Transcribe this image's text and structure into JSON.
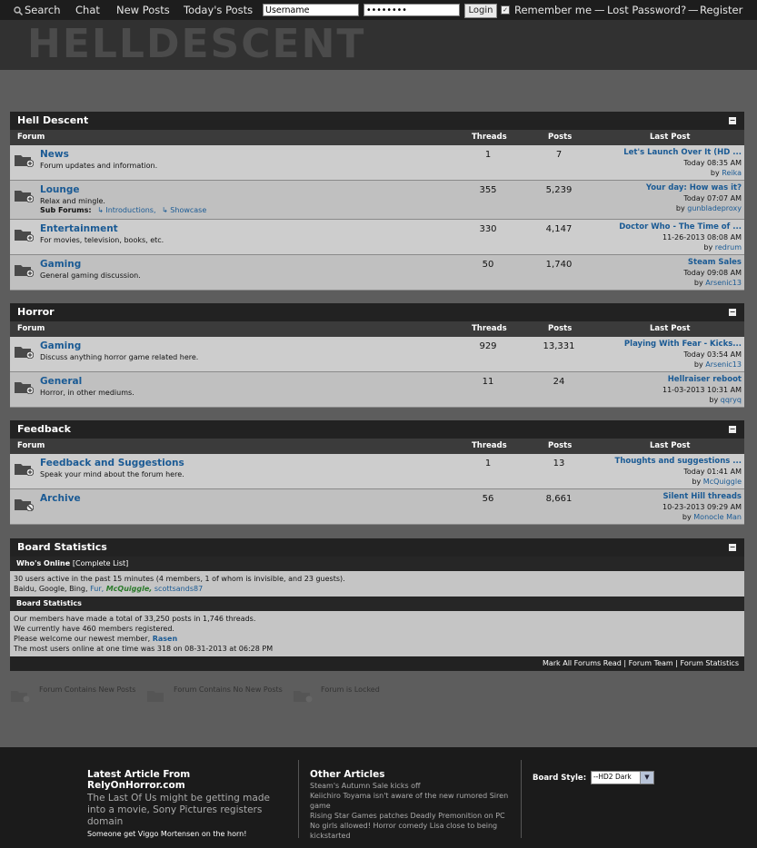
{
  "topnav": {
    "search": "Search",
    "chat": "Chat",
    "new_posts": "New Posts",
    "todays_posts": "Today's Posts",
    "username_value": "Username",
    "password_value": "••••••••",
    "login_label": "Login",
    "remember_label": "Remember me",
    "dash1": "—",
    "lost_password": "Lost Password?",
    "dash2": "—",
    "register": "Register"
  },
  "header": {
    "logo_text": "HELLDESCENT"
  },
  "columns": {
    "forum": "Forum",
    "threads": "Threads",
    "posts": "Posts",
    "last_post": "Last Post"
  },
  "categories": [
    {
      "title": "Hell Descent",
      "toggle": "−",
      "forums": [
        {
          "title": "News",
          "desc": "Forum updates and information.",
          "threads": "1",
          "posts": "7",
          "lp_title": "Let's Launch Over It (HD ...",
          "lp_date": "Today 08:35 AM",
          "lp_by": "by",
          "lp_user": "Reika",
          "status": "new"
        },
        {
          "title": "Lounge",
          "desc": "Relax and mingle.",
          "threads": "355",
          "posts": "5,239",
          "sub_label": "Sub Forums:",
          "sub1": "Introductions,",
          "sub2": "Showcase",
          "lp_title": "Your day: How was it?",
          "lp_date": "Today 07:07 AM",
          "lp_by": "by",
          "lp_user": "gunbladeproxy",
          "status": "new"
        },
        {
          "title": "Entertainment",
          "desc": "For movies, television, books, etc.",
          "threads": "330",
          "posts": "4,147",
          "lp_title": "Doctor Who - The Time of ...",
          "lp_date": "11-26-2013 08:08 AM",
          "lp_by": "by",
          "lp_user": "redrum",
          "status": "new"
        },
        {
          "title": "Gaming",
          "desc": "General gaming discussion.",
          "threads": "50",
          "posts": "1,740",
          "lp_title": "Steam Sales",
          "lp_date": "Today 09:08 AM",
          "lp_by": "by",
          "lp_user": "Arsenic13",
          "status": "new"
        }
      ]
    },
    {
      "title": "Horror",
      "toggle": "−",
      "forums": [
        {
          "title": "Gaming",
          "desc": "Discuss anything horror game related here.",
          "threads": "929",
          "posts": "13,331",
          "lp_title": "Playing With Fear - Kicks...",
          "lp_date": "Today 03:54 AM",
          "lp_by": "by",
          "lp_user": "Arsenic13",
          "status": "new"
        },
        {
          "title": "General",
          "desc": "Horror, in other mediums.",
          "threads": "11",
          "posts": "24",
          "lp_title": "Hellraiser reboot",
          "lp_date": "11-03-2013 10:31 AM",
          "lp_by": "by",
          "lp_user": "qqryq",
          "status": "new"
        }
      ]
    },
    {
      "title": "Feedback",
      "toggle": "−",
      "forums": [
        {
          "title": "Feedback and Suggestions",
          "desc": "Speak your mind about the forum here.",
          "threads": "1",
          "posts": "13",
          "lp_title": "Thoughts and suggestions ...",
          "lp_date": "Today 01:41 AM",
          "lp_by": "by",
          "lp_user": "McQuiggle",
          "status": "new"
        },
        {
          "title": "Archive",
          "desc": "",
          "threads": "56",
          "posts": "8,661",
          "lp_title": "Silent Hill threads",
          "lp_date": "10-23-2013 09:29 AM",
          "lp_by": "by",
          "lp_user": "Monocle Man",
          "status": "locked"
        }
      ]
    }
  ],
  "stats": {
    "title": "Board Statistics",
    "toggle": "−",
    "online_head": "Who's Online",
    "online_link": "[Complete List]",
    "online_line": "30 users active in the past 15 minutes (4 members, 1 of whom is invisible, and 23 guests).",
    "online_users_prefix": "Baidu, Google, Bing,",
    "online_user1": "Fur,",
    "online_user2": "McQuiggle,",
    "online_user3": "scottsands87",
    "stats_head": "Board Statistics",
    "stat1": "Our members have made a total of 33,250 posts in 1,746 threads.",
    "stat2": "We currently have 460 members registered.",
    "stat3_prefix": "Please welcome our newest member,",
    "stat3_user": "Rasen",
    "stat4": "The most users online at one time was 318 on 08-31-2013 at 06:28 PM",
    "foot1": "Mark All Forums Read",
    "sep": "|",
    "foot2": "Forum Team",
    "foot3": "Forum Statistics"
  },
  "legend": {
    "new": "Forum Contains New Posts",
    "nonew": "Forum Contains No New Posts",
    "locked": "Forum is Locked"
  },
  "footer": {
    "latest_head": "Latest Article From RelyOnHorror.com",
    "latest_body": "The Last Of Us might be getting made into a movie, Sony Pictures registers domain",
    "latest_tag": "Someone get Viggo Mortensen on the horn!",
    "other_head": "Other Articles",
    "other1": "Steam's Autumn Sale kicks off",
    "other2": "Keiichiro Toyama isn't aware of the new rumored Siren game",
    "other3": "Rising Star Games patches Deadly Premonition on PC",
    "other4": "No girls allowed! Horror comedy Lisa close to being kickstarted",
    "style_label": "Board Style:",
    "style_value": "--HD2 Dark"
  }
}
